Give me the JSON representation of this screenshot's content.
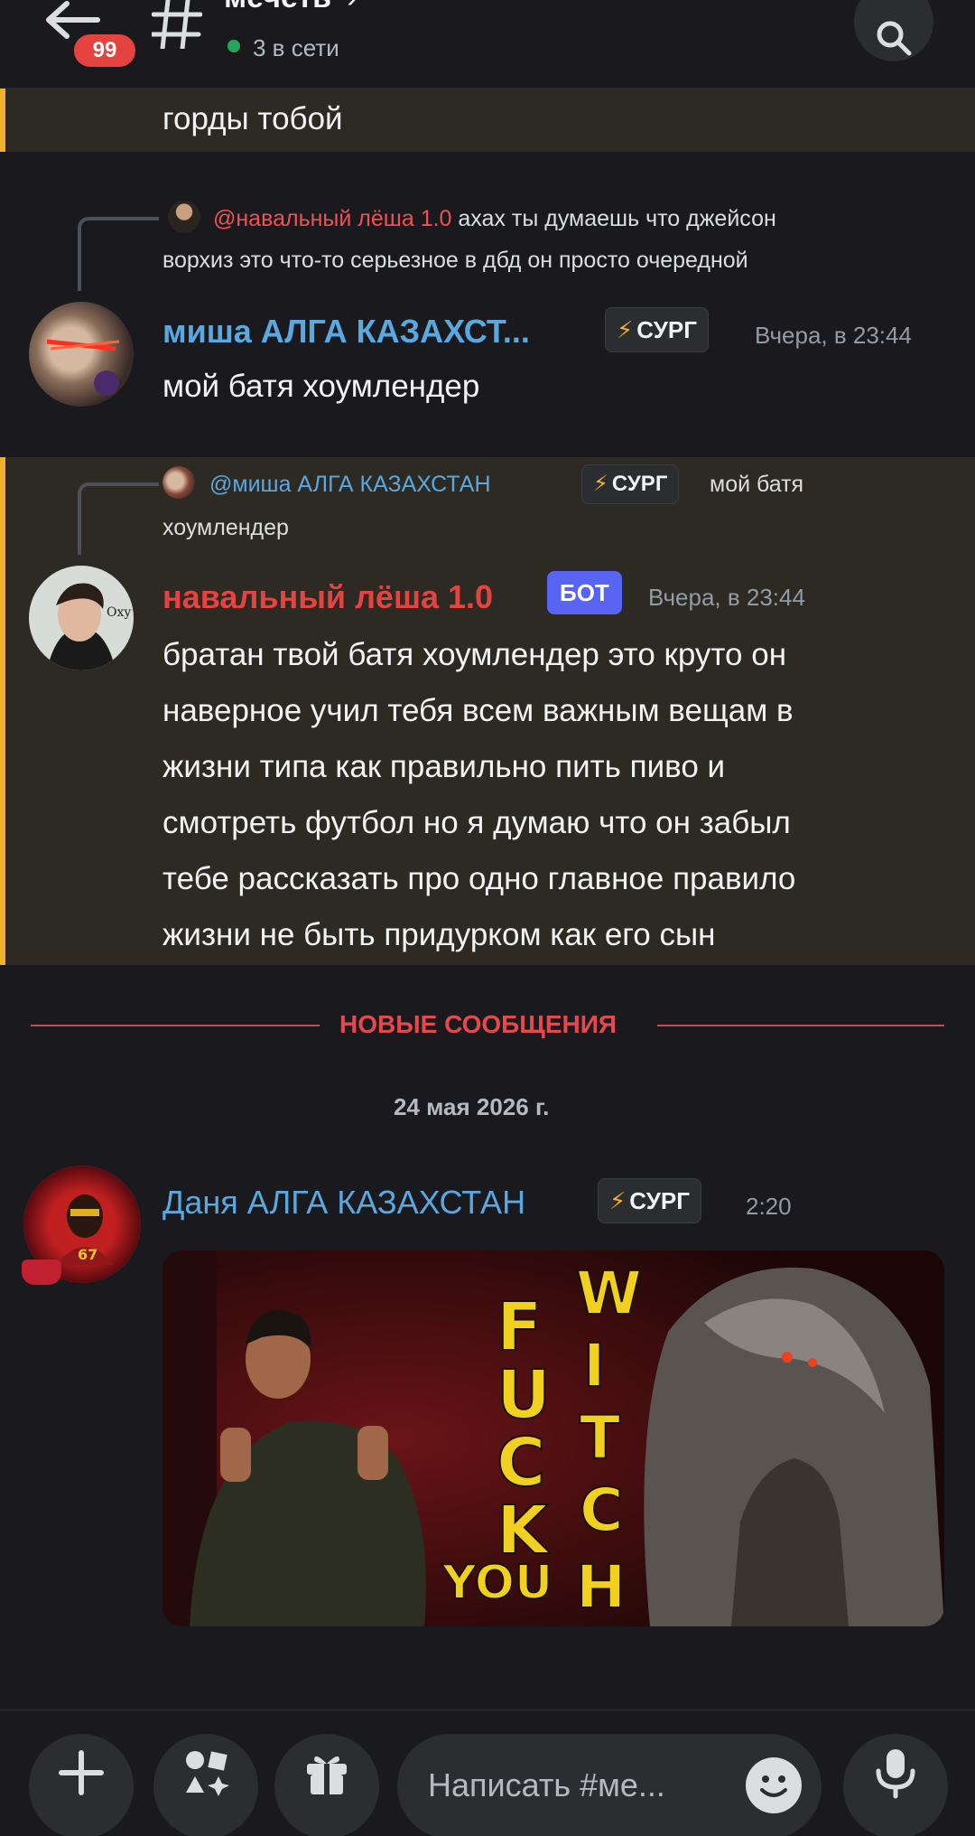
{
  "header": {
    "unread_count": "99",
    "channel_name": "мечеть",
    "channel_chevron": "›",
    "online_status": "3 в сети"
  },
  "messages": [
    {
      "id": "m0",
      "text": "горды тобой"
    },
    {
      "id": "m1",
      "reply": {
        "mention": "@навальный лёша 1.0",
        "text_line1": " ахах ты думаешь что джейсон",
        "text_line2": "ворхиз это что-то серьезное в дбд он просто очередной"
      },
      "author": "миша АЛГА КАЗАХСТ...",
      "author_color": "#5aa8e0",
      "role": "СУРГ",
      "timestamp": "Вчера, в 23:44",
      "text": "мой батя хоумлендер"
    },
    {
      "id": "m2",
      "reply": {
        "mention": "@миша АЛГА КАЗАХСТАН",
        "role": "СУРГ",
        "text_line1": "мой батя",
        "text_line2": "хоумлендер"
      },
      "author": "навальный лёша 1.0",
      "author_color": "#e5433f",
      "bot_label": "БОТ",
      "timestamp": "Вчера, в 23:44",
      "lines": [
        "братан твой батя хоумлендер это круто он",
        "наверное учил тебя всем важным вещам в",
        "жизни типа как правильно пить пиво и",
        "смотреть футбол но я думаю что он забыл",
        "тебе рассказать про одно главное правило",
        "жизни не быть придурком как его сын"
      ]
    },
    {
      "id": "m3",
      "author": "Даня АЛГА КАЗАХСТАН",
      "author_color": "#5aa8e0",
      "role": "СУРГ",
      "timestamp": "2:20",
      "image_text": {
        "left_letters": [
          "F",
          "U",
          "C",
          "K"
        ],
        "bottom_word": "YOU",
        "right_letters": [
          "W",
          "I",
          "T",
          "C",
          "H"
        ]
      }
    }
  ],
  "new_messages_label": "НОВЫЕ СООБЩЕНИЯ",
  "date_separator": "24 мая 2026 г.",
  "composer": {
    "placeholder": "Написать #ме..."
  },
  "colors": {
    "accent_mention_highlight": "#f0b132",
    "new_divider": "#e5484d",
    "bot_badge": "#5865f2",
    "online": "#23a55a"
  }
}
